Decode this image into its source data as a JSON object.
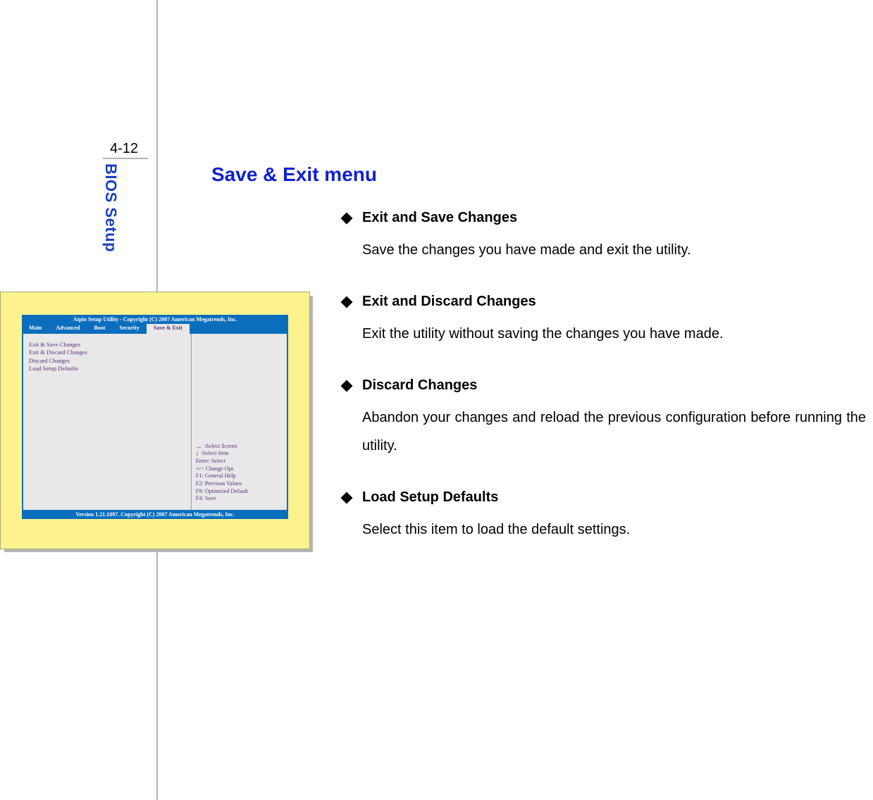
{
  "page_number": "4-12",
  "side_label": "BIOS Setup",
  "title": "Save & Exit menu",
  "items": [
    {
      "head": "Exit and Save Changes",
      "desc": "Save the changes you have made and exit the utility."
    },
    {
      "head": "Exit and Discard Changes",
      "desc": "Exit the utility without saving the changes you have made."
    },
    {
      "head": "Discard Changes",
      "desc": "Abandon your changes and reload the previous configuration before running the utility."
    },
    {
      "head": "Load Setup Defaults",
      "desc": "Select this item to load the default settings."
    }
  ],
  "bios": {
    "header": "Atpio Setup Utility - Copyright (C) 2007 American Megatrends, Inc.",
    "tabs": [
      "Main",
      "Advanced",
      "Boot",
      "Security",
      "Save & Exit"
    ],
    "active_tab_index": 4,
    "menu": [
      "Exit & Save Changes",
      "Exit & Discard Changes",
      "Discard Changes",
      "Load Setup Defaults"
    ],
    "hints": [
      {
        "icon": "↔",
        "label": ":Select Screen"
      },
      {
        "icon": "↕",
        "label": ":Select Item"
      },
      {
        "icon": "",
        "label": "Enter: Select"
      },
      {
        "icon": "",
        "label": "+/-: Change Opt."
      },
      {
        "icon": "",
        "label": "F1: General Help"
      },
      {
        "icon": "",
        "label": "F2: Previous Values"
      },
      {
        "icon": "",
        "label": "F9: Optimized Default"
      },
      {
        "icon": "",
        "label": "F4: Save"
      }
    ],
    "footer": "Version 1.21.1097. Copyright (C) 2007 American Megatrends, Inc."
  }
}
